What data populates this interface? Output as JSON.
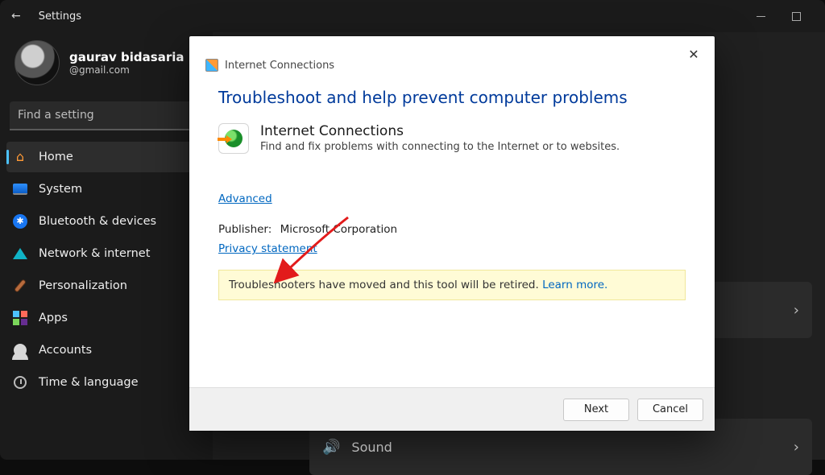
{
  "window": {
    "title": "Settings",
    "minimize_tooltip": "Minimize",
    "maximize_tooltip": "Maximize"
  },
  "profile": {
    "name": "gaurav bidasaria",
    "email_suffix": "@gmail.com"
  },
  "search": {
    "placeholder": "Find a setting"
  },
  "nav": {
    "home": "Home",
    "system": "System",
    "bluetooth": "Bluetooth & devices",
    "network": "Network & internet",
    "personalization": "Personalization",
    "apps": "Apps",
    "accounts": "Accounts",
    "time": "Time & language"
  },
  "content": {
    "sound_label": "Sound"
  },
  "dialog": {
    "breadcrumb": "Internet Connections",
    "heading": "Troubleshoot and help prevent computer problems",
    "item_title": "Internet Connections",
    "item_desc": "Find and fix problems with connecting to the Internet or to websites.",
    "advanced": "Advanced",
    "publisher_label": "Publisher:",
    "publisher_value": "Microsoft Corporation",
    "privacy": "Privacy statement",
    "notice_text": "Troubleshooters have moved and this tool will be retired. ",
    "notice_link": "Learn more.",
    "next": "Next",
    "cancel": "Cancel"
  }
}
